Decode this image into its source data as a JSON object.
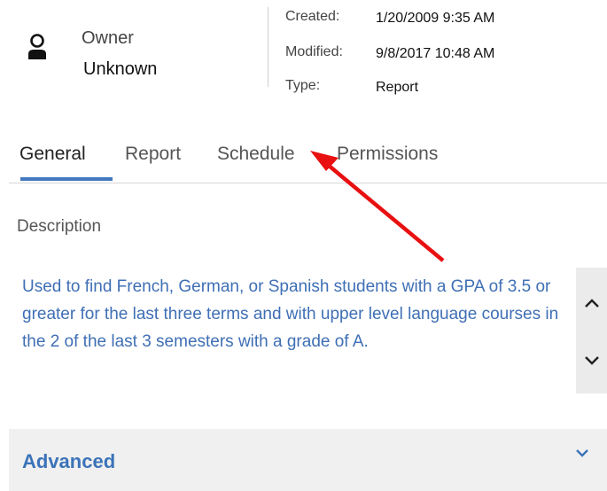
{
  "owner": {
    "label": "Owner",
    "value": "Unknown",
    "icon": "person-icon"
  },
  "meta": {
    "created_label": "Created:",
    "created_value": "1/20/2009 9:35 AM",
    "modified_label": "Modified:",
    "modified_value": "9/8/2017 10:48 AM",
    "type_label": "Type:",
    "type_value": "Report"
  },
  "tabs": [
    {
      "label": "General",
      "active": true
    },
    {
      "label": "Report",
      "active": false
    },
    {
      "label": "Schedule",
      "active": false
    },
    {
      "label": "Permissions",
      "active": false
    }
  ],
  "description": {
    "label": "Description",
    "text": "Used to find French, German, or Spanish students with a GPA of 3.5 or greater for the last three terms and with upper level language courses in the 2 of the last 3 semesters with a grade of A."
  },
  "advanced": {
    "label": "Advanced",
    "expanded": false
  },
  "colors": {
    "accent": "#4178be",
    "description_text": "#3f6fb5",
    "annotation_arrow": "#e81010"
  }
}
